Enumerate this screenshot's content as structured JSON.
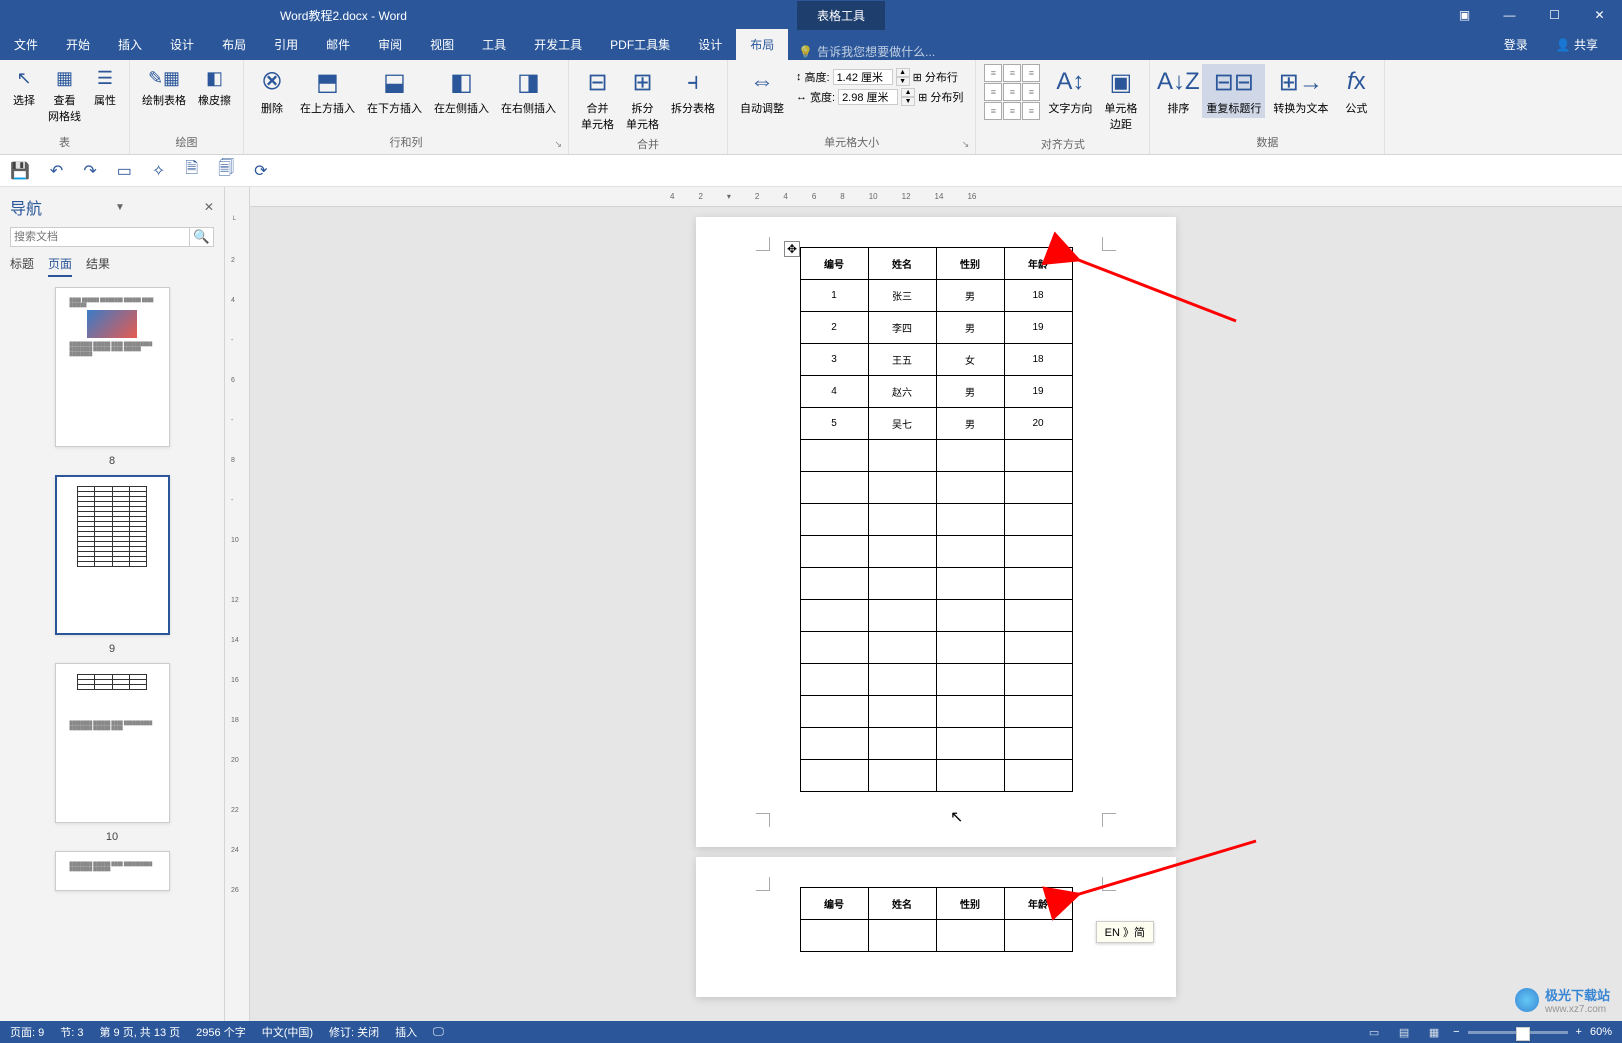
{
  "window": {
    "doc_title": "Word教程2.docx - Word",
    "tool_tab": "表格工具",
    "min": "—",
    "max": "☐",
    "close": "✕",
    "restore": "▣"
  },
  "menu": {
    "file": "文件",
    "home": "开始",
    "insert": "插入",
    "design": "设计",
    "layout": "布局",
    "references": "引用",
    "mail": "邮件",
    "review": "审阅",
    "view": "视图",
    "tools": "工具",
    "devtools": "开发工具",
    "pdf": "PDF工具集",
    "table_design": "设计",
    "table_layout": "布局",
    "tell_me": "告诉我您想要做什么...",
    "login": "登录",
    "share": "共享"
  },
  "ribbon": {
    "select": "选择",
    "gridlines": "查看\n网格线",
    "properties": "属性",
    "group_table": "表",
    "draw": "绘制表格",
    "eraser": "橡皮擦",
    "group_draw": "绘图",
    "delete": "删除",
    "insert_above": "在上方插入",
    "insert_below": "在下方插入",
    "insert_left": "在左侧插入",
    "insert_right": "在右侧插入",
    "group_rowscols": "行和列",
    "merge": "合并\n单元格",
    "split": "拆分\n单元格",
    "split_table": "拆分表格",
    "group_merge": "合并",
    "autofit": "自动调整",
    "height_label": "高度:",
    "height_value": "1.42 厘米",
    "width_label": "宽度:",
    "width_value": "2.98 厘米",
    "dist_rows": "分布行",
    "dist_cols": "分布列",
    "group_cellsize": "单元格大小",
    "text_dir": "文字方向",
    "margins": "单元格\n边距",
    "group_align": "对齐方式",
    "sort": "排序",
    "repeat_header": "重复标题行",
    "to_text": "转换为文本",
    "formula": "公式",
    "group_data": "数据"
  },
  "nav": {
    "title": "导航",
    "search_placeholder": "搜索文档",
    "tab_headings": "标题",
    "tab_pages": "页面",
    "tab_results": "结果",
    "page8": "8",
    "page9": "9",
    "page10": "10"
  },
  "table": {
    "headers": [
      "编号",
      "姓名",
      "性别",
      "年龄"
    ],
    "rows": [
      [
        "1",
        "张三",
        "男",
        "18"
      ],
      [
        "2",
        "李四",
        "男",
        "19"
      ],
      [
        "3",
        "王五",
        "女",
        "18"
      ],
      [
        "4",
        "赵六",
        "男",
        "19"
      ],
      [
        "5",
        "吴七",
        "男",
        "20"
      ]
    ]
  },
  "hruler_marks": [
    "4",
    "2",
    "",
    "2",
    "4",
    "6",
    "8",
    "10",
    "12",
    "14",
    "16"
  ],
  "ime": "EN 》简",
  "status": {
    "page": "页面: 9",
    "section": "节: 3",
    "page_of": "第 9 页, 共 13 页",
    "words": "2956 个字",
    "lang": "中文(中国)",
    "track": "修订: 关闭",
    "insert": "插入",
    "zoom": "60%"
  },
  "watermark": {
    "name": "极光下载站",
    "url": "www.xz7.com"
  }
}
